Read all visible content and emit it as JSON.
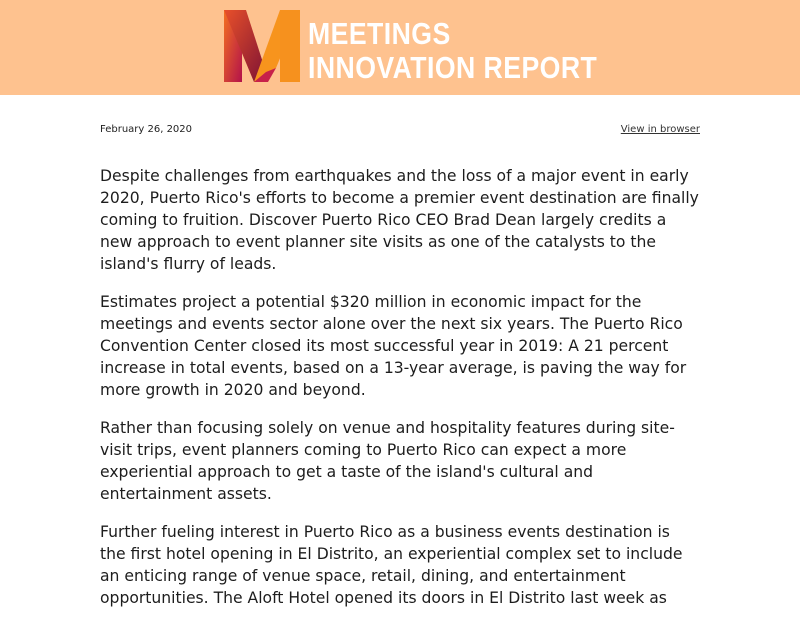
{
  "header": {
    "brand_line1": "MEETINGS",
    "brand_line2": "INNOVATION REPORT",
    "logo_icon": "stylized-m-logo-icon",
    "background_color": "#fec28f",
    "logo_colors": [
      "#f7941d",
      "#e8502a",
      "#c7214a",
      "#8a1538"
    ]
  },
  "meta": {
    "date": "February 26, 2020",
    "view_in_browser": "View in browser"
  },
  "article": {
    "paragraphs": [
      "Despite challenges from earthquakes and the loss of a major event in early 2020, Puerto Rico's efforts to become a premier event destination are finally coming to fruition. Discover Puerto Rico CEO Brad Dean largely credits a new approach to event planner site visits as one of the catalysts to the island's flurry of leads.",
      "Estimates project a potential $320 million in economic impact for the meetings and events sector alone over the next six years. The Puerto Rico Convention Center closed its most successful year in 2019: A 21 percent increase in total events, based on a 13-year average, is paving the way for more growth in 2020 and beyond.",
      "Rather than focusing solely on venue and hospitality features during site-visit trips, event planners coming to Puerto Rico can expect a more experiential approach to get a taste of the island's cultural and entertainment assets.",
      "Further fueling interest in Puerto Rico as a business events destination is the first hotel opening in El Distrito, an experiential complex set to include an enticing range of venue space, retail, dining, and entertainment opportunities. The Aloft Hotel opened its doors in El Distrito last week as"
    ]
  }
}
